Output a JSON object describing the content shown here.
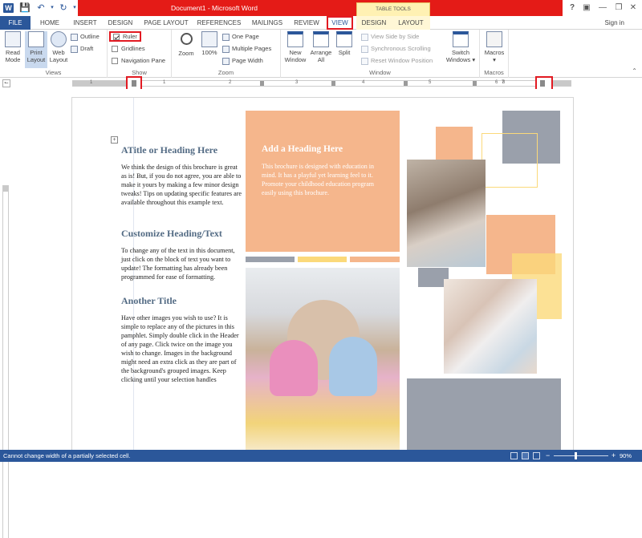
{
  "window": {
    "title": "Document1 - Microsoft Word",
    "context_tab_group": "TABLE TOOLS",
    "help": "?",
    "sign_in": "Sign in"
  },
  "tabs": [
    "FILE",
    "HOME",
    "INSERT",
    "DESIGN",
    "PAGE LAYOUT",
    "REFERENCES",
    "MAILINGS",
    "REVIEW",
    "VIEW",
    "DESIGN",
    "LAYOUT"
  ],
  "ribbon": {
    "views": {
      "label": "Views",
      "read_mode": "Read Mode",
      "print_layout": "Print Layout",
      "web_layout": "Web Layout",
      "outline": "Outline",
      "draft": "Draft"
    },
    "show": {
      "label": "Show",
      "ruler": "Ruler",
      "gridlines": "Gridlines",
      "navigation_pane": "Navigation Pane",
      "ruler_checked": true,
      "gridlines_checked": false,
      "navigation_pane_checked": false
    },
    "zoom": {
      "label": "Zoom",
      "zoom": "Zoom",
      "hundred": "100%",
      "one_page": "One Page",
      "multiple_pages": "Multiple Pages",
      "page_width": "Page Width"
    },
    "window": {
      "label": "Window",
      "new_window": "New Window",
      "arrange_all": "Arrange All",
      "split": "Split",
      "view_side_by_side": "View Side by Side",
      "synchronous_scrolling": "Synchronous Scrolling",
      "reset_window_position": "Reset Window Position",
      "switch_windows": "Switch Windows"
    },
    "macros": {
      "label": "Macros",
      "macros": "Macros"
    }
  },
  "ruler_numbers": [
    "1",
    "1",
    "2",
    "3",
    "4",
    "5",
    "6",
    "7",
    "8",
    "9"
  ],
  "document": {
    "heading1": "ATitle or Heading Here",
    "para1": "We think the design of this brochure is great as is!  But, if you do not agree, you are able to make it yours by making a few minor design tweaks!  Tips on updating specific features are available throughout this example text.",
    "heading2": "Customize Heading/Text",
    "para2": "To change any of the text in this document, just click on the block of text you want to update!  The formatting has already been programmed for ease of formatting.",
    "heading3": "Another Title",
    "para3": "Have other images you wish to use?  It is simple to replace any of the pictures in this pamphlet.  Simply double click in the Header of any page.  Click twice on the image you wish to change.  Images in the background might need an extra click as they are part of the background's grouped images.  Keep clicking until your selection handles",
    "panel_heading": "Add a Heading Here",
    "panel_text": "This brochure is designed with education in mind.  It has a playful yet learning feel to it.  Promote your childhood education program easily using this brochure."
  },
  "status": {
    "message": "Cannot change width of a partially selected cell.",
    "zoom": "90%"
  },
  "colors": {
    "title_red": "#e41b17",
    "file_blue": "#2b579a",
    "peach": "#f5b68c",
    "gray_block": "#9aa0ab",
    "yellow": "#fbd97a"
  }
}
